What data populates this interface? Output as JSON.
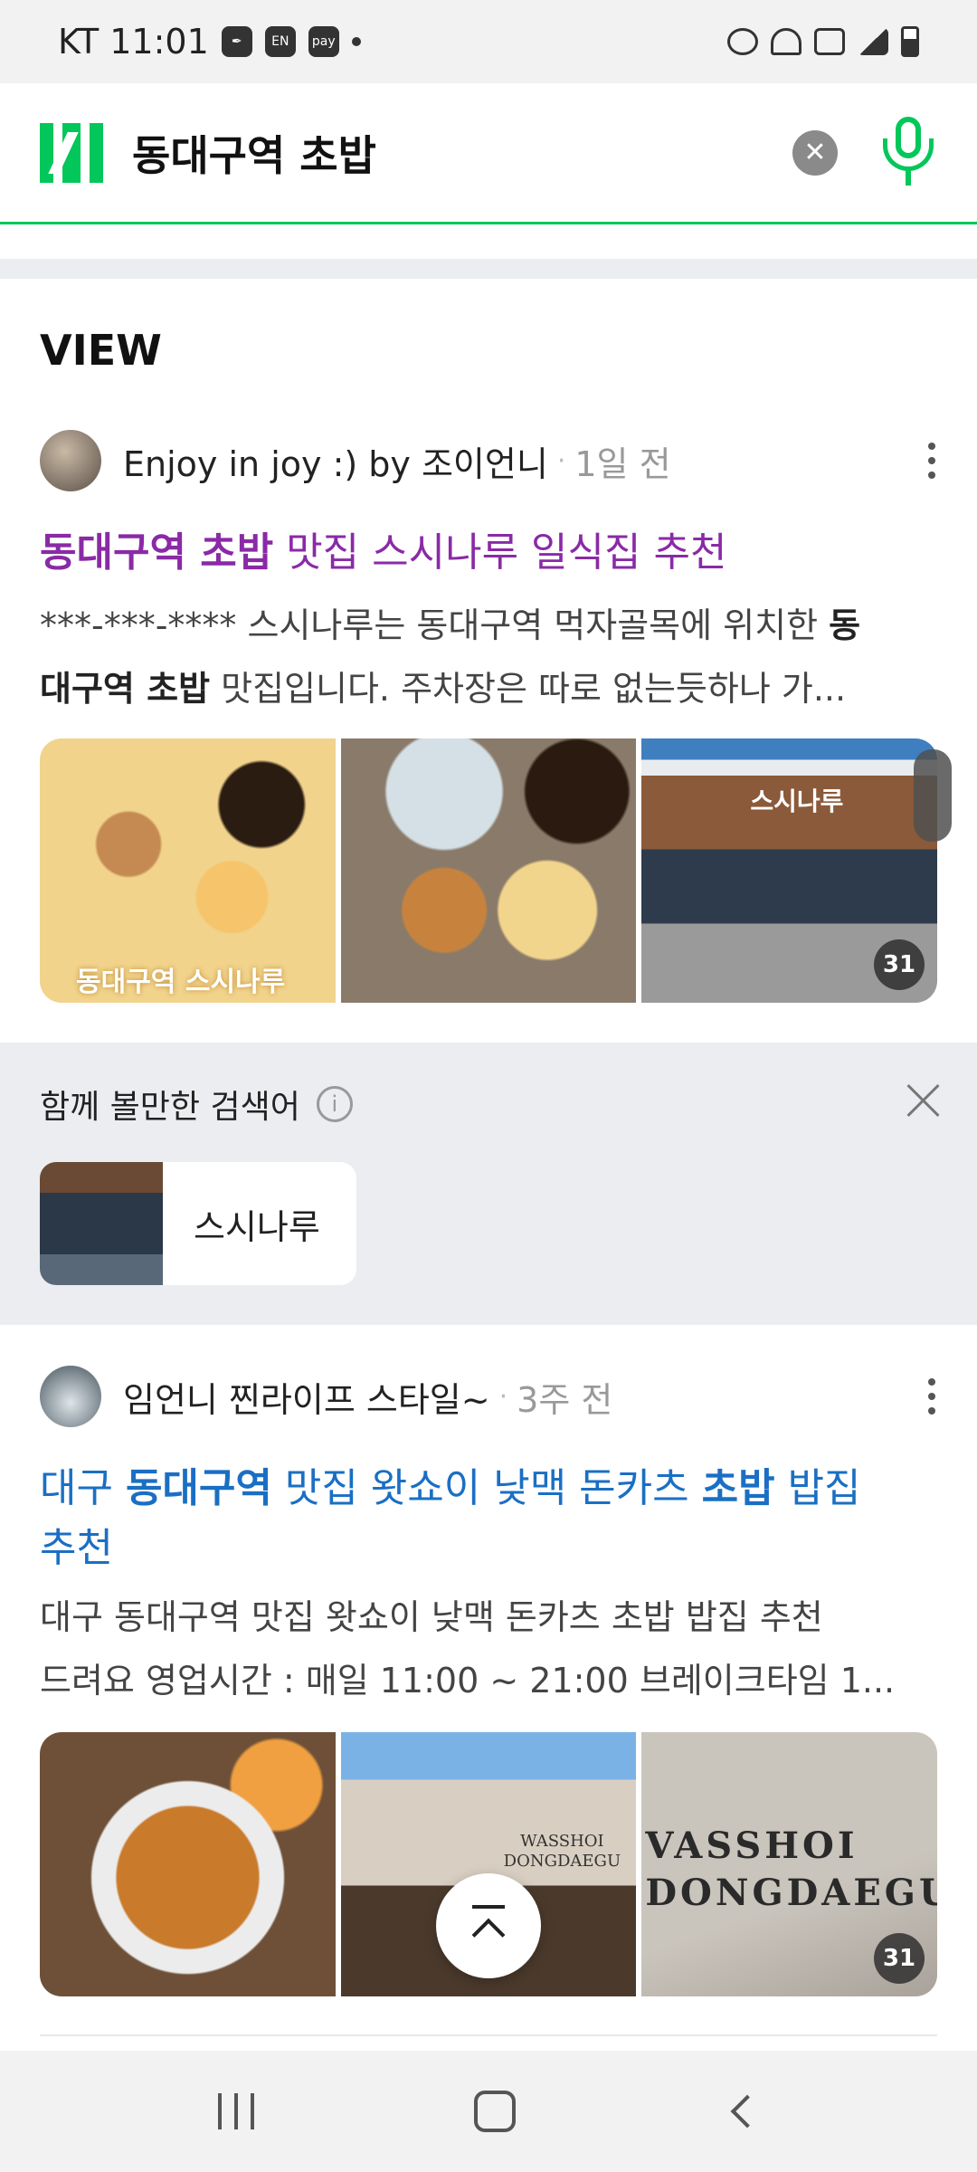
{
  "status_bar": {
    "carrier_time": "KT 11:01",
    "icons": [
      "en-icon",
      "pay-icon",
      "alarm-icon",
      "wifi-icon",
      "hd-icon",
      "signal-icon",
      "battery-icon"
    ]
  },
  "search": {
    "query": "동대구역 초밥",
    "logo": "N"
  },
  "view": {
    "section_title": "VIEW",
    "posts": [
      {
        "author": "Enjoy in joy :) by 조이언니",
        "time": "1일 전",
        "title_parts": [
          "동대구역 초밥",
          " 맛집 스시나루 일식집 추천"
        ],
        "snippet_line1_plain": "***-***-**** 스시나루는 동대구역 먹자골목에 위치한 ",
        "snippet_line1_bold": "동",
        "snippet_line2_bold": "대구역 초밥",
        "snippet_line2_plain": " 맛집입니다. 주차장은 따로 없는듯하나 가...",
        "thumb_caption": "동대구역 스시나루",
        "thumb_sign": "스시나루",
        "image_count": "31"
      },
      {
        "author": "임언니 찐라이프 스타일~",
        "time": "3주 전",
        "title_plain1": "대구 ",
        "title_bold1": "동대구역",
        "title_plain2": " 맛집 왓쇼이 낮맥 돈카츠 ",
        "title_bold2": "초밥",
        "title_plain3": " 밥집",
        "title_line2": "추천",
        "snippet_line1": "대구 동대구역 맛집 왓쇼이 낮맥 돈카츠 초밥 밥집 추천",
        "snippet_line2": "드려요 영업시간 : 매일 11:00 ~ 21:00 브레이크타임 1...",
        "sign_small_1": "WASSHOI",
        "sign_small_2": "DONGDAEGU",
        "sign_large_1": "VASSHOI",
        "sign_large_2": "DONGDAEGU",
        "image_count": "31"
      }
    ]
  },
  "related": {
    "title": "함께 볼만한 검색어",
    "items": [
      {
        "label": "스시나루"
      }
    ]
  },
  "colors": {
    "brand": "#03c75a",
    "visited_title": "#8a2aa6",
    "link_title": "#1a6fc4"
  }
}
